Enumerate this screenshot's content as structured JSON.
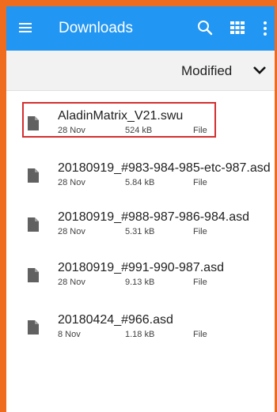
{
  "appbar": {
    "title": "Downloads",
    "icons": [
      "menu-icon",
      "search-icon",
      "grid-view-icon",
      "more-vert-icon"
    ],
    "color": "#2196f3"
  },
  "sort": {
    "label": "Modified",
    "icon": "chevron-down-icon"
  },
  "files": [
    {
      "name": "AladinMatrix_V21.swu",
      "date": "28 Nov",
      "size": "524 kB",
      "type": "File",
      "highlighted": true
    },
    {
      "name": "20180919_#983-984-985-etc-987.asd",
      "date": "28 Nov",
      "size": "5.84 kB",
      "type": "File"
    },
    {
      "name": "20180919_#988-987-986-984.asd",
      "date": "28 Nov",
      "size": "5.31 kB",
      "type": "File"
    },
    {
      "name": "20180919_#991-990-987.asd",
      "date": "28 Nov",
      "size": "9.13 kB",
      "type": "File"
    },
    {
      "name": "20180424_#966.asd",
      "date": "8 Nov",
      "size": "1.18 kB",
      "type": "File"
    }
  ],
  "colors": {
    "frame": "#ef6c1f",
    "highlight": "#d32f2f"
  }
}
